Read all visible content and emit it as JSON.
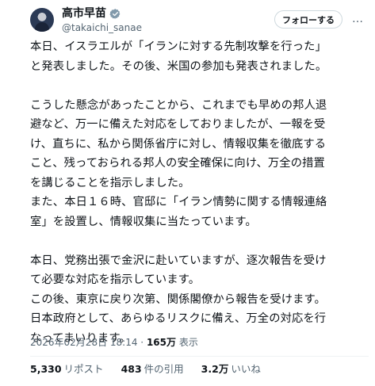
{
  "author": {
    "name": "高市早苗",
    "handle": "@takaichi_sanae",
    "verified_color": "#829aab"
  },
  "actions": {
    "follow_label": "フォローする",
    "more_label": "…"
  },
  "tweet": {
    "paragraphs": [
      {
        "lines": [
          "本日、イスラエルが「イランに対する先制攻撃を行った」",
          "と発表しました。その後、米国の参加も発表されました。"
        ]
      },
      {
        "lines": [
          "こうした懸念があったことから、これまでも早めの邦人退",
          "避など、万一に備えた対応をしておりましたが、一報を受",
          "け、直ちに、私から関係省庁に対し、情報収集を徹底する",
          "こと、残っておられる邦人の安全確保に向け、万全の措置",
          "を講じることを指示しました。",
          "また、本日１６時、官邸に「イラン情勢に関する情報連絡",
          "室」を設置し、情報収集に当たっています。"
        ]
      },
      {
        "lines": [
          "本日、党務出張で金沢に赴いていますが、逐次報告を受け",
          "て必要な対応を指示しています。",
          "この後、東京に戻り次第、関係閣僚から報告を受けます。",
          "日本政府として、あらゆるリスクに備え、万全の対応を行",
          "なってまいります。"
        ]
      }
    ],
    "timestamp": "2026年02月28日 18:14",
    "separator": " · ",
    "views_count": "165万",
    "views_label": " 表示"
  },
  "stats": {
    "reposts_count": "5,330",
    "reposts_label": "リポスト",
    "quotes_count": "483",
    "quotes_label": "件の引用",
    "likes_count": "3.2万",
    "likes_label": "いいね"
  }
}
